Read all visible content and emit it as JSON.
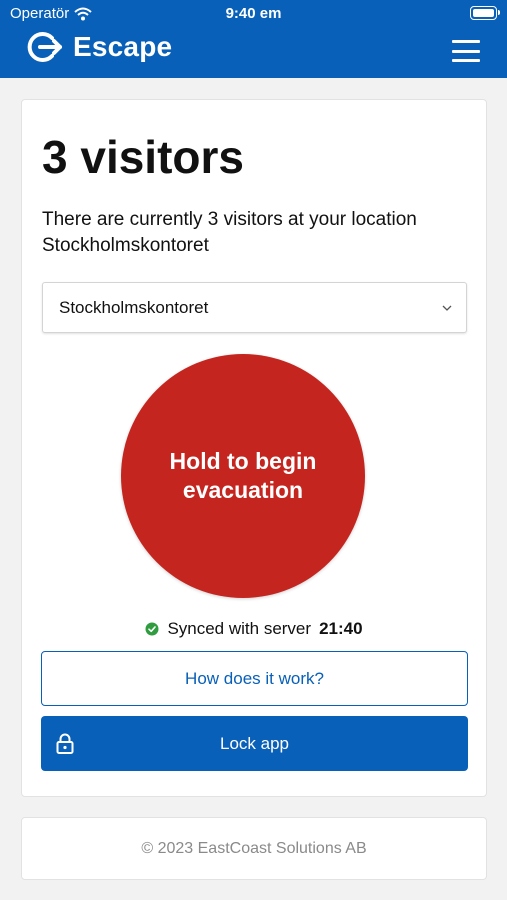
{
  "status_bar": {
    "carrier": "Operatör",
    "time": "9:40 em"
  },
  "header": {
    "app_name": "Escape",
    "logo_icon": "exit-arrow-icon",
    "menu_icon": "hamburger-menu-icon"
  },
  "main": {
    "title": "3 visitors",
    "description": "There are currently 3 visitors at your location Stockholmskontoret",
    "location_select": {
      "value": "Stockholmskontoret"
    },
    "evacuation_button": "Hold to begin evacuation",
    "sync": {
      "text": "Synced with server",
      "time": "21:40",
      "icon": "check-circle-icon"
    },
    "how_button": "How does it work?",
    "lock_button": "Lock app",
    "lock_icon": "lock-icon"
  },
  "footer": {
    "copyright": "© 2023 EastCoast Solutions AB"
  },
  "colors": {
    "brand_blue": "#0860b8",
    "evacuate_red": "#c4261f",
    "sync_green": "#2f9d3f"
  }
}
